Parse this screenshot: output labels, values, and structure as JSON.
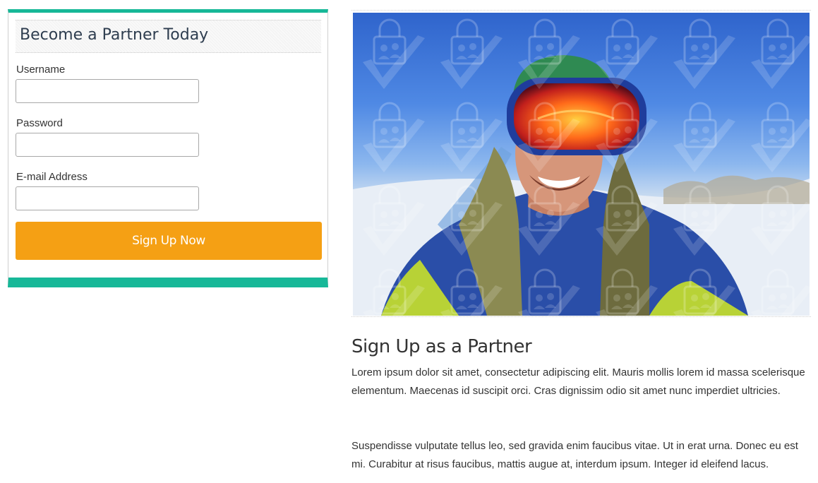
{
  "form": {
    "title": "Become a Partner Today",
    "fields": [
      {
        "label": "Username",
        "value": "",
        "placeholder": ""
      },
      {
        "label": "Password",
        "value": "",
        "placeholder": ""
      },
      {
        "label": "E-mail Address",
        "value": "",
        "placeholder": ""
      }
    ],
    "submit_label": "Sign Up Now"
  },
  "hero": {
    "image": "snowboarder-with-goggles-photo",
    "watermark": "lock-and-checkmark-pattern"
  },
  "content": {
    "title": "Sign Up as a Partner",
    "paragraphs": [
      "Lorem ipsum dolor sit amet, consectetur adipiscing elit. Mauris mollis lorem id massa scelerisque elementum. Maecenas id suscipit orci. Cras dignissim odio sit amet nunc imperdiet ultricies.",
      "Suspendisse vulputate tellus leo, sed gravida enim faucibus vitae. Ut in erat urna. Donec eu est mi. Curabitur at risus faucibus, mattis augue at, interdum ipsum. Integer id eleifend lacus."
    ]
  },
  "colors": {
    "accent": "#17b898",
    "button": "#f5a014",
    "heading": "#2e3d4f"
  }
}
